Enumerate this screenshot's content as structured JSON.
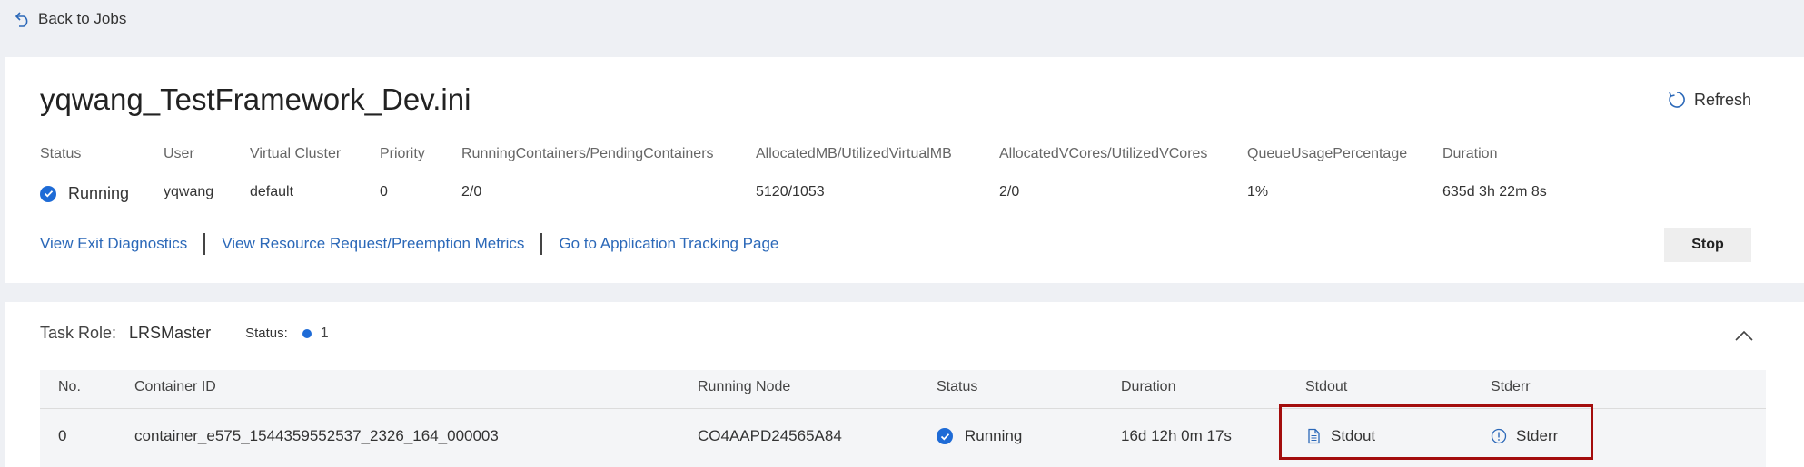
{
  "nav": {
    "back_label": "Back to Jobs"
  },
  "job": {
    "title": "yqwang_TestFramework_Dev.ini",
    "refresh_label": "Refresh",
    "columns": {
      "status": "Status",
      "user": "User",
      "vc": "Virtual Cluster",
      "priority": "Priority",
      "containers": "RunningContainers/PendingContainers",
      "mem": "AllocatedMB/UtilizedVirtualMB",
      "vcores": "AllocatedVCores/UtilizedVCores",
      "queue": "QueueUsagePercentage",
      "duration": "Duration"
    },
    "values": {
      "status": "Running",
      "user": "yqwang",
      "vc": "default",
      "priority": "0",
      "containers": "2/0",
      "mem": "5120/1053",
      "vcores": "2/0",
      "queue": "1%",
      "duration": "635d 3h 22m 8s"
    },
    "links": {
      "exit_diag": "View Exit Diagnostics",
      "resource": "View Resource Request/Preemption Metrics",
      "tracking": "Go to Application Tracking Page"
    },
    "stop_label": "Stop"
  },
  "task_role": {
    "label": "Task Role:",
    "name": "LRSMaster",
    "status_label": "Status:",
    "status_count": "1",
    "columns": {
      "no": "No.",
      "container_id": "Container ID",
      "node": "Running Node",
      "status": "Status",
      "duration": "Duration",
      "stdout": "Stdout",
      "stderr": "Stderr"
    },
    "rows": [
      {
        "no": "0",
        "container_id": "container_e575_1544359552537_2326_164_000003",
        "node": "CO4AAPD24565A84",
        "status": "Running",
        "duration": "16d 12h 0m 17s",
        "stdout": "Stdout",
        "stderr": "Stderr"
      }
    ]
  },
  "colors": {
    "accent": "#1e6bd6",
    "link": "#2b68b8",
    "highlight": "#a30d0d",
    "background": "#eef0f4"
  },
  "icons": [
    "back-arrow-icon",
    "refresh-icon",
    "check-circle-icon",
    "chevron-up-icon",
    "document-icon",
    "info-circle-icon"
  ]
}
